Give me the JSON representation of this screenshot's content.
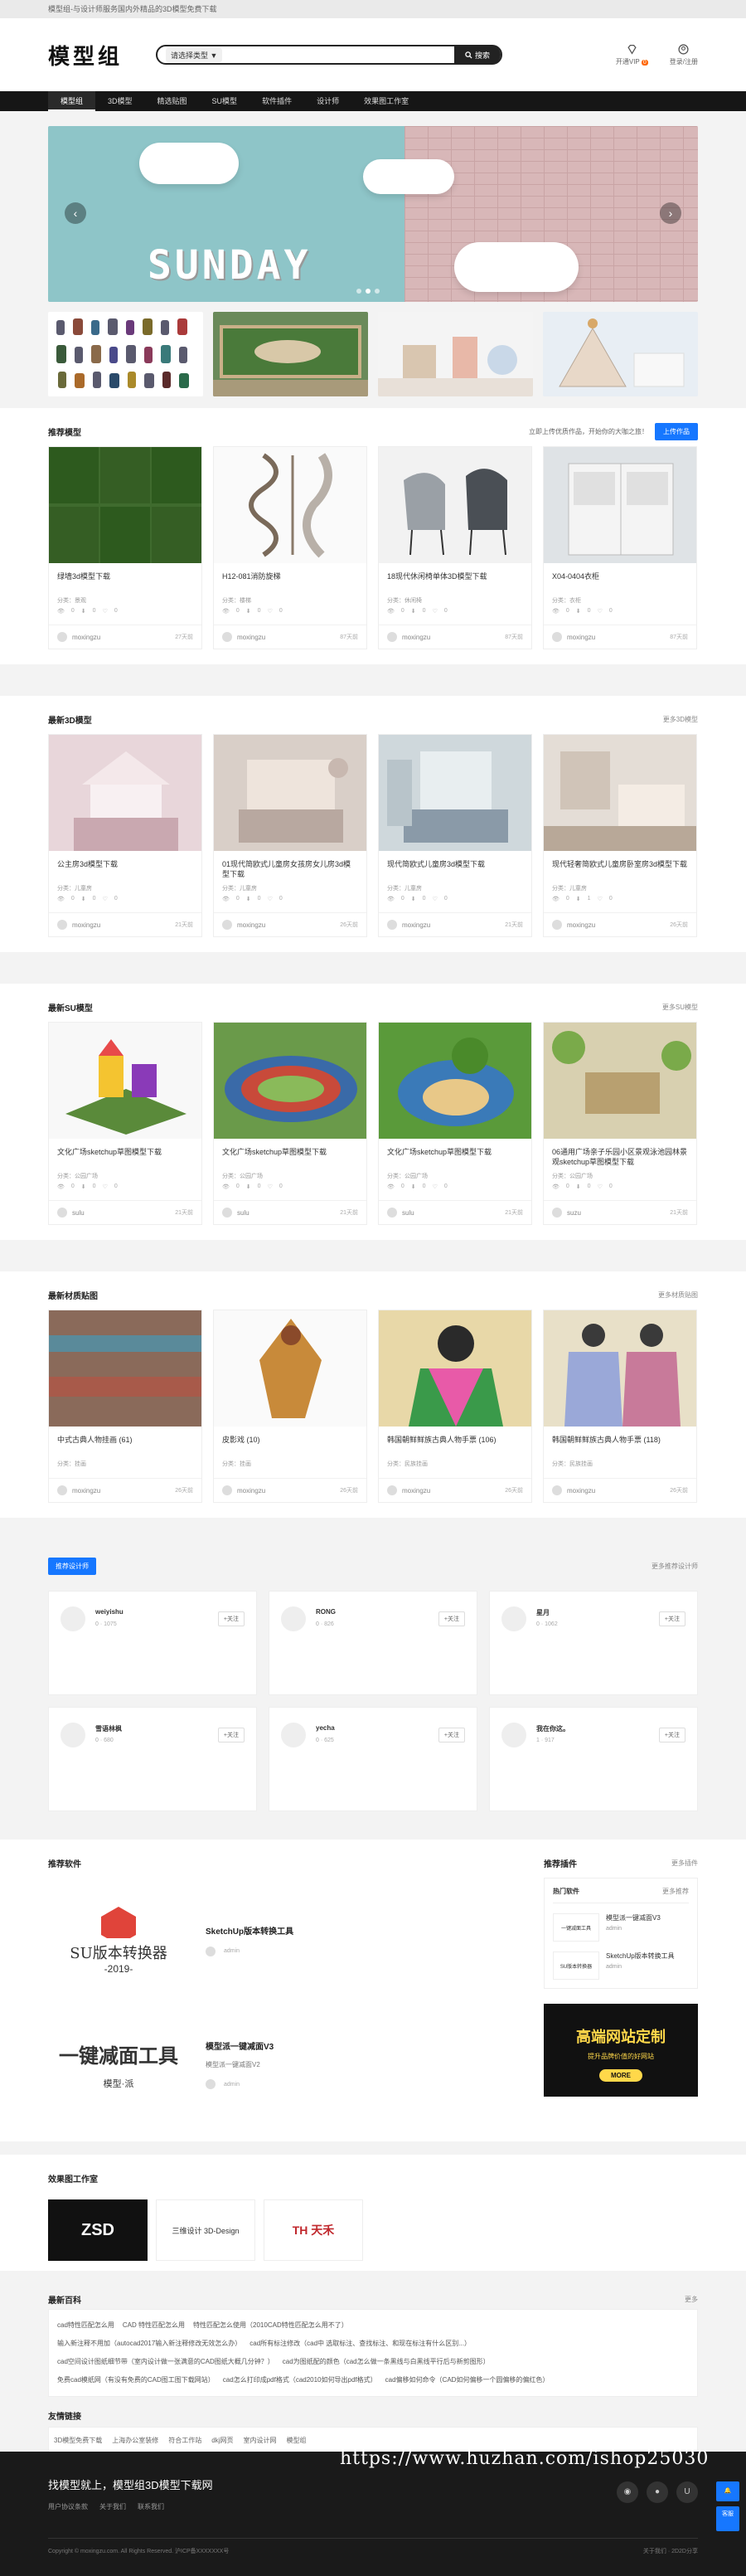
{
  "topbar": {
    "notice": "模型组-与设计师服务国内外精品的3D模型免费下载"
  },
  "header": {
    "logo": "模型组",
    "search_select": "请选择类型 ▼",
    "search_button": "搜索",
    "right": [
      {
        "label": "开通VIP",
        "badge": "0"
      },
      {
        "label": "登录/注册"
      }
    ]
  },
  "nav": [
    "模型组",
    "3D模型",
    "精选贴图",
    "SU模型",
    "软件插件",
    "设计师",
    "效果图工作室"
  ],
  "banner": {
    "text": "SUNDAY"
  },
  "recommend": {
    "title": "推荐模型",
    "tip": "立即上传优质作品，开始你的大咖之旅！",
    "upload": "上传作品",
    "items": [
      {
        "title": "绿墙3d模型下载",
        "cat": "分类：景观",
        "stats": [
          "0",
          "0",
          "0"
        ],
        "author": "moxingzu",
        "time": "27天前"
      },
      {
        "title": "H12-081消防旋梯",
        "cat": "分类：楼梯",
        "stats": [
          "0",
          "0",
          "0"
        ],
        "author": "moxingzu",
        "time": "87天前"
      },
      {
        "title": "18现代休闲椅单体3D模型下载",
        "cat": "分类：休闲椅",
        "stats": [
          "0",
          "0",
          "0"
        ],
        "author": "moxingzu",
        "time": "87天前"
      },
      {
        "title": "X04-0404衣柜",
        "cat": "分类：衣柜",
        "stats": [
          "0",
          "0",
          "0"
        ],
        "author": "moxingzu",
        "time": "87天前"
      }
    ]
  },
  "latest3d": {
    "title": "最新3D模型",
    "more": "更多3D模型",
    "items": [
      {
        "title": "公主房3d模型下载",
        "cat": "分类：儿童房",
        "stats": [
          "0",
          "0",
          "0"
        ],
        "author": "moxingzu",
        "time": "21天前"
      },
      {
        "title": "01现代简欧式儿童房女孩房女儿房3d模型下载",
        "cat": "分类：儿童房",
        "stats": [
          "0",
          "0",
          "0"
        ],
        "author": "moxingzu",
        "time": "26天前"
      },
      {
        "title": "现代简欧式儿童房3d模型下载",
        "cat": "分类：儿童房",
        "stats": [
          "0",
          "0",
          "0"
        ],
        "author": "moxingzu",
        "time": "21天前"
      },
      {
        "title": "现代轻奢简欧式儿童房卧室房3d模型下载",
        "cat": "分类：儿童房",
        "stats": [
          "0",
          "1",
          "0"
        ],
        "author": "moxingzu",
        "time": "26天前"
      }
    ]
  },
  "latestsu": {
    "title": "最新SU模型",
    "more": "更多SU模型",
    "items": [
      {
        "title": "文化广场sketchup草图模型下载",
        "cat": "分类：公园广场",
        "stats": [
          "0",
          "0",
          "0"
        ],
        "author": "sulu",
        "time": "21天前"
      },
      {
        "title": "文化广场sketchup草图模型下载",
        "cat": "分类：公园广场",
        "stats": [
          "0",
          "0",
          "0"
        ],
        "author": "sulu",
        "time": "21天前"
      },
      {
        "title": "文化广场sketchup草图模型下载",
        "cat": "分类：公园广场",
        "stats": [
          "0",
          "0",
          "0"
        ],
        "author": "sulu",
        "time": "21天前"
      },
      {
        "title": "06通用广场亲子乐园小区景观泳池园林景观sketchup草图模型下载",
        "cat": "分类：公园广场",
        "stats": [
          "0",
          "0",
          "0"
        ],
        "author": "suzu",
        "time": "21天前"
      }
    ]
  },
  "textures": {
    "title": "最新材质贴图",
    "more": "更多材质贴图",
    "items": [
      {
        "title": "中式古典人物挂画 (61)",
        "cat": "分类：挂画",
        "stats": [
          "0",
          "0",
          "0"
        ],
        "author": "moxingzu",
        "time": "26天前"
      },
      {
        "title": "皮影戏 (10)",
        "cat": "分类：挂画",
        "stats": [
          "0",
          "0",
          "0"
        ],
        "author": "moxingzu",
        "time": "26天前"
      },
      {
        "title": "韩国朝鲜鲜族古典人物手票 (106)",
        "cat": "分类：民族挂画",
        "stats": [
          "0",
          "0",
          "0"
        ],
        "author": "moxingzu",
        "time": "26天前"
      },
      {
        "title": "韩国朝鲜鲜族古典人物手票 (118)",
        "cat": "分类：民族挂画",
        "stats": [
          "0",
          "0",
          "0"
        ],
        "author": "moxingzu",
        "time": "26天前"
      }
    ]
  },
  "designers": {
    "tag": "推荐设计师",
    "more": "更多推荐设计师",
    "items": [
      {
        "name": "weiyishu",
        "works": "0",
        "fans": "1075",
        "follow": "+关注"
      },
      {
        "name": "RONG",
        "works": "0",
        "fans": "826",
        "follow": "+关注"
      },
      {
        "name": "星月",
        "works": "0",
        "fans": "1062",
        "follow": "+关注"
      },
      {
        "name": "雪语林枫",
        "works": "0",
        "fans": "680",
        "follow": "+关注"
      },
      {
        "name": "yecha",
        "works": "0",
        "fans": "625",
        "follow": "+关注"
      },
      {
        "name": "我在你这。",
        "works": "1",
        "fans": "917",
        "follow": "+关注"
      }
    ]
  },
  "software": {
    "title": "推荐软件",
    "items": [
      {
        "name": "SketchUp版本转换工具",
        "sub": "",
        "author": "admin",
        "logo_text": "SU版本转换器",
        "logo_year": "-2019-"
      },
      {
        "name": "模型派一键减面V3",
        "sub": "模型派一键减面V2",
        "author": "admin",
        "logo_text": "一键减面工具",
        "logo_brand": "模型·派"
      }
    ]
  },
  "plugins": {
    "title": "推荐插件",
    "more": "更多插件",
    "tab_a": "热门软件",
    "tab_b": "更多推荐",
    "items": [
      {
        "title": "模型派一键减面V3",
        "author": "admin",
        "img": "一键减面工具"
      },
      {
        "title": "SketchUp版本转换工具",
        "author": "admin",
        "img": "SU版本转换器"
      }
    ],
    "ad_big": "高端网站定制",
    "ad_small": "提升品牌价值的好网站",
    "ad_more": "MORE"
  },
  "studios": {
    "title": "效果图工作室",
    "items": [
      "ZSD",
      "三维设计 3D-Design",
      "TH 天禾"
    ]
  },
  "articles": {
    "title": "最新百科",
    "more": "更多",
    "rows": [
      [
        "cad特性匹配怎么用",
        "CAD 特性匹配怎么用",
        "特性匹配怎么使用（2010CAD特性匹配怎么用不了）"
      ],
      [
        "输入新注释不用加（autocad2017输入新注释修改无效怎么办）",
        "cad所有标注修改（cad中 选取标注、查找标注、和现在标注有什么区别...）"
      ],
      [
        "cad空间设计图纸细节带（室内设计做一张满意的CAD图纸大概几分钟？）",
        "cad为图纸配的颜色（cad怎么做一条黑线与白黑线平行后与新剪图形）"
      ],
      [
        "免费cad模纸网（有没有免费的CAD图工图下载网站）",
        "cad怎么打印成pdf格式（cad2010如何导出pdf格式）",
        "cad偏移如何命令（CAD如何偏移一个圆偏移的偏红色）"
      ]
    ]
  },
  "friendlinks": {
    "title": "友情链接",
    "items": [
      "3D模型免费下载",
      "上海办公室装修",
      "符合工作站",
      "dkj网页",
      "室内设计网",
      "模型组"
    ]
  },
  "footer": {
    "title": "找模型就上，模型组3D模型下载网",
    "links": [
      "用户协议条款",
      "关于我们",
      "联系我们"
    ],
    "copy": "Copyright © moxingzu.com. All Rights Reserved. 沪ICP备XXXXXXX号",
    "right": "关于我们 · 2D2D分享"
  },
  "watermark": "https://www.huzhan.com/ishop25030",
  "float": {
    "top": "回到顶部",
    "service": "客服"
  },
  "colors": {
    "accent": "#1677ff",
    "nav_bg": "#161616",
    "footer_bg": "#1a1a1a"
  }
}
